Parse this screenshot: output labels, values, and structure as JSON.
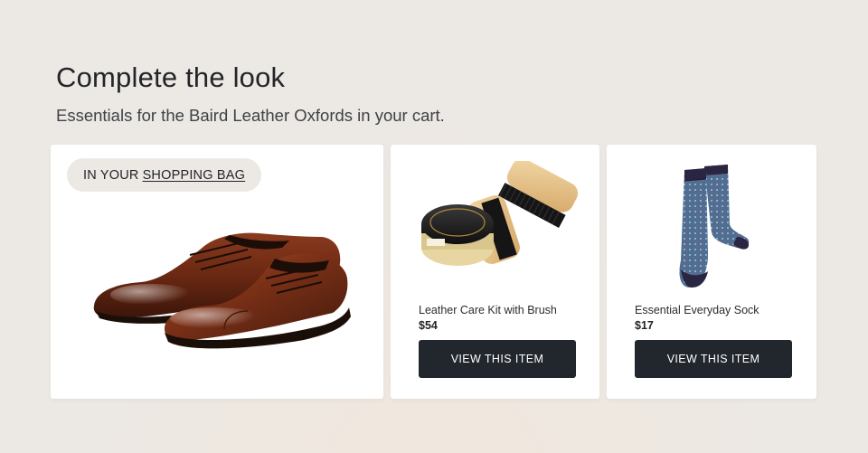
{
  "section": {
    "title": "Complete the look",
    "subtitle": "Essentials for the Baird Leather Oxfords in your cart."
  },
  "cart_item": {
    "pill_prefix": "IN YOUR",
    "pill_link": "SHOPPING BAG",
    "image_icon": "leather-oxford-shoes-image"
  },
  "recommendations": [
    {
      "name": "Leather Care Kit with Brush",
      "price": "$54",
      "button_label": "VIEW THIS ITEM",
      "image_icon": "leather-care-kit-image"
    },
    {
      "name": "Essential Everyday Sock",
      "price": "$17",
      "button_label": "VIEW THIS ITEM",
      "image_icon": "sock-pair-image"
    }
  ],
  "colors": {
    "background": "#ece8e4",
    "card": "#ffffff",
    "button": "#22262d",
    "text": "#1f2125"
  }
}
